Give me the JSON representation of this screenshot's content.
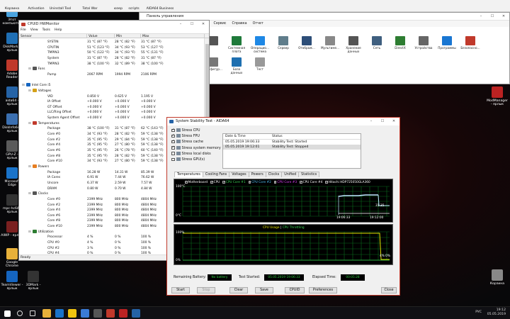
{
  "desktop": {
    "icons": [
      {
        "label": "Этот компьютер",
        "color": "#4aa3df"
      },
      {
        "label": "DiskMark... ярлык",
        "color": "#1f6fb5"
      },
      {
        "label": "Adobe Reader",
        "color": "#c0392b"
      },
      {
        "label": "aida64 - ярлык",
        "color": "#2563a6"
      },
      {
        "label": "DiskInfo64 - ярлык",
        "color": "#3b6fb0"
      },
      {
        "label": "GPU-Z - ярлык",
        "color": "#5a5a5a"
      },
      {
        "label": "Microsoft Edge",
        "color": "#1a73c9"
      },
      {
        "label": "mpc-hc64 - ярлык",
        "color": "#333"
      },
      {
        "label": "AIWP - ярлык",
        "color": "#7a2020"
      },
      {
        "label": "Google Chrome",
        "color": "#e8b13a"
      },
      {
        "label": "TeamViewer - ярлык",
        "color": "#1565c0"
      },
      {
        "label": "3DMark - ярлык",
        "color": "#333"
      }
    ],
    "right_icons": [
      {
        "label": "Empire - ярлык",
        "color": "#7a1a1a"
      },
      {
        "label": "Rome2 - ярлык",
        "color": "#444"
      },
      {
        "label": "Attila - ярлык",
        "color": "#3a3a3a"
      },
      {
        "label": "ModManager - ярлык",
        "color": "#b22"
      },
      {
        "label": "Корзина",
        "color": "#888"
      }
    ]
  },
  "top_strip": {
    "items": [
      "Корзина",
      "Activation",
      "Uninstall Tool",
      "Total War",
      "юзер",
      "scripts",
      "AIDA64 Business"
    ]
  },
  "explorer": {
    "title": "Панель управления",
    "menu": [
      "Файл",
      "Правка",
      "Вид",
      "Избранное",
      "Сервис",
      "Справка",
      "Отчет"
    ],
    "items": [
      {
        "label": "",
        "color": "#555"
      },
      {
        "label": "Системная плата",
        "color": "#1f7a3a"
      },
      {
        "label": "Операцио... система",
        "color": "#1e88e5"
      },
      {
        "label": "Сервер",
        "color": "#607d8b"
      },
      {
        "label": "Отображ...",
        "color": "#2d4e78"
      },
      {
        "label": "Мультиме...",
        "color": "#888"
      },
      {
        "label": "Хранение данных",
        "color": "#555"
      },
      {
        "label": "Сеть",
        "color": "#3f5f7f"
      },
      {
        "label": "DirectX",
        "color": "#2e7d32"
      },
      {
        "label": "Устройства",
        "color": "#666"
      },
      {
        "label": "Программы",
        "color": "#1976d2"
      },
      {
        "label": "Безопасно...",
        "color": "#c0392b"
      },
      {
        "label": "Конфигур...",
        "color": "#777"
      },
      {
        "label": "База данных",
        "color": "#1e6fb0"
      },
      {
        "label": "Тест",
        "color": "#999"
      }
    ]
  },
  "hwmonitor": {
    "title": "CPUID HWMonitor",
    "menu": [
      "File",
      "View",
      "Tools",
      "Help"
    ],
    "columns": [
      "Sensor",
      "Value",
      "Min",
      "Max"
    ],
    "status": "Ready",
    "rows": [
      {
        "kind": "item",
        "indent": 2,
        "name": "SYSTIN",
        "value": "31 °C (87 °F)",
        "min": "28 °C (82 °F)",
        "max": "31 °C (87 °F)"
      },
      {
        "kind": "item",
        "indent": 2,
        "name": "CPUTIN",
        "value": "51 °C (123 °F)",
        "min": "34 °C (93 °F)",
        "max": "53 °C (127 °F)"
      },
      {
        "kind": "item",
        "indent": 2,
        "name": "TMPIN3",
        "value": "50 °C (122 °F)",
        "min": "34 °C (93 °F)",
        "max": "55 °C (131 °F)"
      },
      {
        "kind": "item",
        "indent": 2,
        "name": "System",
        "value": "31 °C (87 °F)",
        "min": "28 °C (82 °F)",
        "max": "31 °C (87 °F)"
      },
      {
        "kind": "item",
        "indent": 2,
        "name": "TMPIN3",
        "value": "38 °C (100 °F)",
        "min": "32 °C (89 °F)",
        "max": "38 °C (100 °F)"
      },
      {
        "kind": "section",
        "indent": 1,
        "name": "Fans",
        "color": "#555"
      },
      {
        "kind": "item",
        "indent": 2,
        "name": "Pump",
        "value": "2067 RPM",
        "min": "1994 RPM",
        "max": "2106 RPM"
      },
      {
        "kind": "blank"
      },
      {
        "kind": "section",
        "indent": 0,
        "name": "Intel Core i5",
        "color": "#1565c0"
      },
      {
        "kind": "section",
        "indent": 1,
        "name": "Voltages",
        "color": "#d4a017"
      },
      {
        "kind": "item",
        "indent": 2,
        "name": "VID",
        "value": "0.850 V",
        "min": "0.625 V",
        "max": "1.195 V"
      },
      {
        "kind": "item",
        "indent": 2,
        "name": "IA Offset",
        "value": "+0.000 V",
        "min": "+0.000 V",
        "max": "+0.000 V"
      },
      {
        "kind": "item",
        "indent": 2,
        "name": "GT Offset",
        "value": "+0.000 V",
        "min": "+0.000 V",
        "max": "+0.000 V"
      },
      {
        "kind": "item",
        "indent": 2,
        "name": "LLC/Ring Offset",
        "value": "+0.000 V",
        "min": "+0.000 V",
        "max": "+0.000 V"
      },
      {
        "kind": "item",
        "indent": 2,
        "name": "System Agent Offset",
        "value": "+0.000 V",
        "min": "+0.000 V",
        "max": "+0.000 V"
      },
      {
        "kind": "section",
        "indent": 1,
        "name": "Temperatures",
        "color": "#c0392b"
      },
      {
        "kind": "item",
        "indent": 2,
        "name": "Package",
        "value": "38 °C (100 °F)",
        "min": "31 °C (87 °F)",
        "max": "62 °C (143 °F)"
      },
      {
        "kind": "item",
        "indent": 2,
        "name": "Core #0",
        "value": "34 °C (93 °F)",
        "min": "28 °C (82 °F)",
        "max": "59 °C (138 °F)"
      },
      {
        "kind": "item",
        "indent": 2,
        "name": "Core #2",
        "value": "35 °C (95 °F)",
        "min": "29 °C (84 °F)",
        "max": "59 °C (138 °F)"
      },
      {
        "kind": "item",
        "indent": 2,
        "name": "Core #4",
        "value": "35 °C (95 °F)",
        "min": "27 °C (80 °F)",
        "max": "59 °C (138 °F)"
      },
      {
        "kind": "item",
        "indent": 2,
        "name": "Core #6",
        "value": "35 °C (95 °F)",
        "min": "26 °C (78 °F)",
        "max": "60 °C (140 °F)"
      },
      {
        "kind": "item",
        "indent": 2,
        "name": "Core #8",
        "value": "35 °C (95 °F)",
        "min": "28 °C (82 °F)",
        "max": "59 °C (138 °F)"
      },
      {
        "kind": "item",
        "indent": 2,
        "name": "Core #10",
        "value": "34 °C (93 °F)",
        "min": "27 °C (80 °F)",
        "max": "59 °C (138 °F)"
      },
      {
        "kind": "section",
        "indent": 1,
        "name": "Powers",
        "color": "#e67e22"
      },
      {
        "kind": "item",
        "indent": 2,
        "name": "Package",
        "value": "16.28 W",
        "min": "14.31 W",
        "max": "85.39 W"
      },
      {
        "kind": "item",
        "indent": 2,
        "name": "IA Cores",
        "value": "6.91 W",
        "min": "7.44 W",
        "max": "76.62 W"
      },
      {
        "kind": "item",
        "indent": 2,
        "name": "Uncore",
        "value": "6.37 W",
        "min": "2.59 W",
        "max": "7.57 W"
      },
      {
        "kind": "item",
        "indent": 2,
        "name": "DRAM",
        "value": "0.80 W",
        "min": "0.70 W",
        "max": "4.84 W"
      },
      {
        "kind": "section",
        "indent": 1,
        "name": "Clocks",
        "color": "#555"
      },
      {
        "kind": "item",
        "indent": 2,
        "name": "Core #0",
        "value": "2399 MHz",
        "min": "800 MHz",
        "max": "4804 MHz"
      },
      {
        "kind": "item",
        "indent": 2,
        "name": "Core #2",
        "value": "2399 MHz",
        "min": "800 MHz",
        "max": "4804 MHz"
      },
      {
        "kind": "item",
        "indent": 2,
        "name": "Core #4",
        "value": "2399 MHz",
        "min": "800 MHz",
        "max": "4804 MHz"
      },
      {
        "kind": "item",
        "indent": 2,
        "name": "Core #6",
        "value": "2399 MHz",
        "min": "800 MHz",
        "max": "4804 MHz"
      },
      {
        "kind": "item",
        "indent": 2,
        "name": "Core #8",
        "value": "2399 MHz",
        "min": "800 MHz",
        "max": "4804 MHz"
      },
      {
        "kind": "item",
        "indent": 2,
        "name": "Core #10",
        "value": "2399 MHz",
        "min": "800 MHz",
        "max": "4804 MHz"
      },
      {
        "kind": "section",
        "indent": 1,
        "name": "Utilization",
        "color": "#2e7d32"
      },
      {
        "kind": "item",
        "indent": 2,
        "name": "Processor",
        "value": "4 %",
        "min": "0 %",
        "max": "100 %"
      },
      {
        "kind": "item",
        "indent": 2,
        "name": "CPU #0",
        "value": "4 %",
        "min": "0 %",
        "max": "100 %"
      },
      {
        "kind": "item",
        "indent": 2,
        "name": "CPU #2",
        "value": "3 %",
        "min": "0 %",
        "max": "100 %"
      },
      {
        "kind": "item",
        "indent": 2,
        "name": "CPU #4",
        "value": "0 %",
        "min": "0 %",
        "max": "100 %"
      }
    ]
  },
  "aida": {
    "title": "System Stability Test - AIDA64",
    "checks": [
      {
        "label": "Stress CPU",
        "checked": true
      },
      {
        "label": "Stress FPU",
        "checked": true
      },
      {
        "label": "Stress cache",
        "checked": true
      },
      {
        "label": "Stress system memory",
        "checked": true
      },
      {
        "label": "Stress local disks",
        "checked": false
      },
      {
        "label": "Stress GPU(s)",
        "checked": false
      }
    ],
    "log_headers": [
      "Date & Time",
      "Status"
    ],
    "log_rows": [
      {
        "time": "05.05.2019 19:06:33",
        "status": "Stability Test: Started"
      },
      {
        "time": "05.05.2019 19:12:01",
        "status": "Stability Test: Stopped"
      }
    ],
    "tabs": [
      "Temperatures",
      "Cooling Fans",
      "Voltages",
      "Powers",
      "Clocks",
      "Unified",
      "Statistics"
    ],
    "legend": [
      {
        "label": "Motherboard",
        "color": "#ffffff"
      },
      {
        "label": "CPU",
        "color": "#ffffff"
      },
      {
        "label": "CPU Core #1",
        "color": "#39d353"
      },
      {
        "label": "CPU Core #2",
        "color": "#4fc3f7"
      },
      {
        "label": "CPU Core #3",
        "color": "#e040fb"
      },
      {
        "label": "CPU Core #4",
        "color": "#ffffff"
      },
      {
        "label": "Hitachi HDP725050GLA360",
        "color": "#ffffff"
      }
    ],
    "graph1": {
      "ymax": "100°C",
      "ymin": "0°C",
      "t1": "19:06:33",
      "t2": "19:12:00",
      "end_values": "31 35"
    },
    "graph2": {
      "title_a": "CPU Usage",
      "title_sep": "|",
      "title_b": "CPU Throttling",
      "ymax": "100%",
      "ymin": "0%",
      "end_values": "4% 0%"
    },
    "info": {
      "battery_label": "Remaining Battery:",
      "battery_value": "No battery",
      "started_label": "Test Started:",
      "started_value": "05.05.2019 19:06:33",
      "elapsed_label": "Elapsed Time:",
      "elapsed_value": "00:05:28"
    },
    "buttons": {
      "start": "Start",
      "stop": "Stop",
      "clear": "Clear",
      "save": "Save",
      "cpuid": "CPUID",
      "preferences": "Preferences",
      "close": "Close"
    }
  },
  "taskbar": {
    "time": "19:12",
    "date": "05.05.2019",
    "lang": "РУС",
    "apps": [
      {
        "name": "start",
        "color": "#ffffff"
      },
      {
        "name": "search",
        "color": "#dddddd"
      },
      {
        "name": "task-view",
        "color": "#dddddd"
      },
      {
        "name": "chrome",
        "color": "#e8b13a"
      },
      {
        "name": "edge",
        "color": "#1a73c9"
      },
      {
        "name": "explorer",
        "color": "#f1c40f"
      },
      {
        "name": "store",
        "color": "#3a7bd5"
      },
      {
        "name": "calculator",
        "color": "#555"
      },
      {
        "name": "app-red",
        "color": "#c0392b"
      },
      {
        "name": "hwmonitor",
        "color": "#b22"
      },
      {
        "name": "aida64",
        "color": "#2563a6"
      }
    ]
  }
}
